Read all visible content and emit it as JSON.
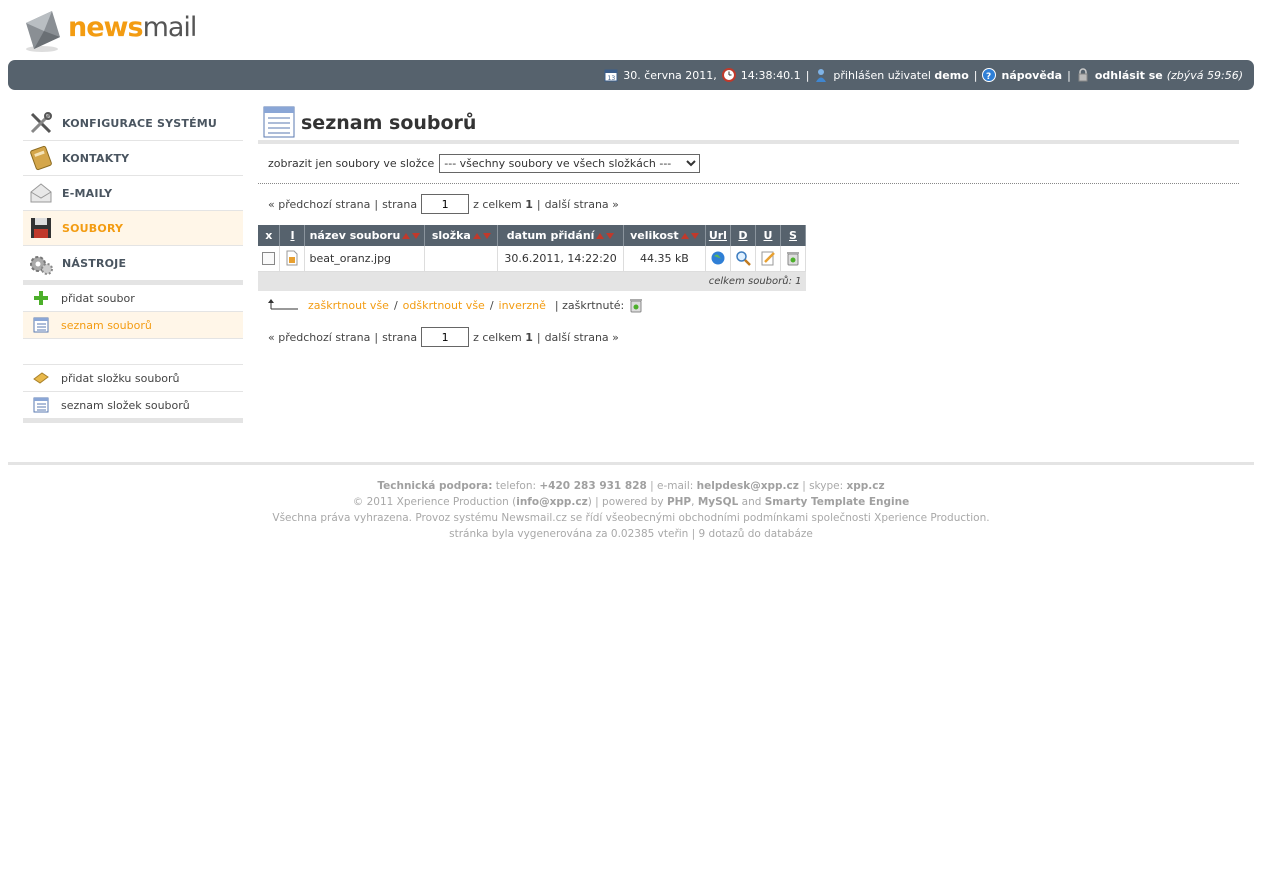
{
  "logo": {
    "part1": "news",
    "part2": "mail"
  },
  "topbar": {
    "date": "30. června 2011,",
    "time": "14:38:40.1",
    "logged_in_text": "přihlášen uživatel",
    "username": "demo",
    "help": "nápověda",
    "logout": "odhlásit se",
    "remaining": "(zbývá 59:56)",
    "sep": "|"
  },
  "sidebar": {
    "main_items": [
      {
        "label": "KONFIGURACE SYSTÉMU"
      },
      {
        "label": "KONTAKTY"
      },
      {
        "label": "E-MAILY"
      },
      {
        "label": "SOUBORY"
      },
      {
        "label": "NÁSTROJE"
      }
    ],
    "sub_items": [
      {
        "label": "přidat soubor"
      },
      {
        "label": "seznam souborů"
      },
      {
        "label": "přidat složku souborů"
      },
      {
        "label": "seznam složek souborů"
      }
    ]
  },
  "main": {
    "title": "seznam souborů",
    "filter_label": "zobrazit jen soubory ve složce",
    "filter_value": "--- všechny soubory ve všech složkách ---",
    "pager": {
      "prev": "« předchozí strana",
      "page_label": "strana",
      "page_value": "1",
      "total_label": "z celkem",
      "total": "1",
      "next": "další strana »",
      "sep": "|"
    },
    "table": {
      "headers": [
        "x",
        "I",
        "název souboru",
        "složka",
        "datum přidání",
        "velikost",
        "Url",
        "D",
        "U",
        "S"
      ],
      "rows": [
        {
          "name": "beat_oranz.jpg",
          "folder": "",
          "date": "30.6.2011, 14:22:20",
          "size": "44.35 kB"
        }
      ],
      "summary": "celkem souborů: 1"
    },
    "actions": {
      "check_all": "zaškrtnout vše",
      "uncheck_all": "odškrtnout vše",
      "invert": "inverzně",
      "checked_label": "| zaškrtnuté:",
      "slash": "/"
    }
  },
  "footer": {
    "line1_a": "Technická podpora:",
    "line1_b": " telefon: ",
    "phone": "+420 283 931 828",
    "line1_c": " | e-mail: ",
    "email": "helpdesk@xpp.cz",
    "line1_d": " | skype: ",
    "skype": "xpp.cz",
    "line2_a": "© 2011 Xperience Production (",
    "info_email": "info@xpp.cz",
    "line2_b": ") | powered by ",
    "php": "PHP",
    "comma": ", ",
    "mysql": "MySQL",
    "and": " and ",
    "smarty": "Smarty Template Engine",
    "line3": "Všechna práva vyhrazena. Provoz systému Newsmail.cz se řídí všeobecnými obchodními podmínkami společnosti Xperience Production.",
    "line4": "stránka byla vygenerována za 0.02385 vteřin | 9 dotazů do databáze"
  },
  "colors": {
    "accent": "#f39c12",
    "bar": "#56626d",
    "sort_arrow": "#c0392b"
  }
}
